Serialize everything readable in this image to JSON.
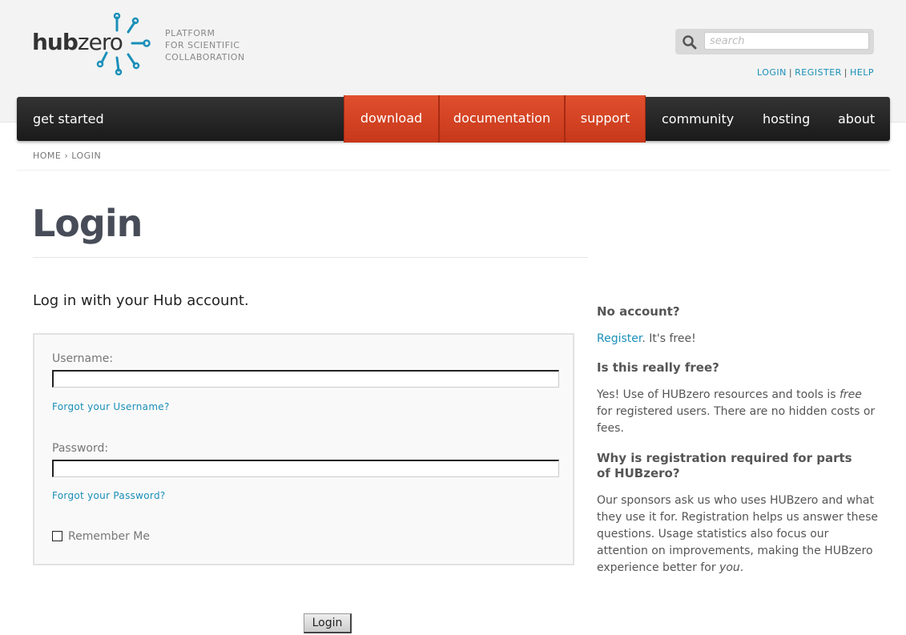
{
  "brand": {
    "logo_hub": "hub",
    "logo_zero": "zero",
    "tagline": [
      "PLATFORM",
      "FOR SCIENTIFIC",
      "COLLABORATION"
    ],
    "accent_color": "#1a8fb8"
  },
  "search": {
    "placeholder": "search",
    "icon": "search-icon"
  },
  "top_links": {
    "login": "LOGIN",
    "register": "REGISTER",
    "help": "HELP"
  },
  "nav": {
    "get_started": "get started",
    "download": "download",
    "documentation": "documentation",
    "support": "support",
    "community": "community",
    "hosting": "hosting",
    "about": "about",
    "highlight_color": "#d9431f"
  },
  "breadcrumb": {
    "home": "HOME",
    "current": "LOGIN"
  },
  "page": {
    "title": "Login",
    "subhead": "Log in with your Hub account."
  },
  "form": {
    "username_label": "Username:",
    "username_value": "",
    "forgot_username": "Forgot your Username?",
    "password_label": "Password:",
    "password_value": "",
    "forgot_password": "Forgot your Password?",
    "remember_label": "Remember Me",
    "remember_checked": false,
    "submit_label": "Login"
  },
  "sidebar": {
    "no_account_heading": "No account?",
    "register_link": "Register",
    "register_suffix": ". It's free!",
    "free_heading": "Is this really free?",
    "free_text_1": "Yes! Use of HUBzero resources and tools is ",
    "free_text_em": "free",
    "free_text_2": " for registered users. There are no hidden costs or fees.",
    "why_heading": "Why is registration required for parts of HUBzero?",
    "why_text_1": "Our sponsors ask us who uses HUBzero and what they use it for. Registration helps us answer these questions. Usage statistics also focus our attention on improvements, making the HUBzero experience better for ",
    "why_text_em": "you",
    "why_text_2": "."
  }
}
